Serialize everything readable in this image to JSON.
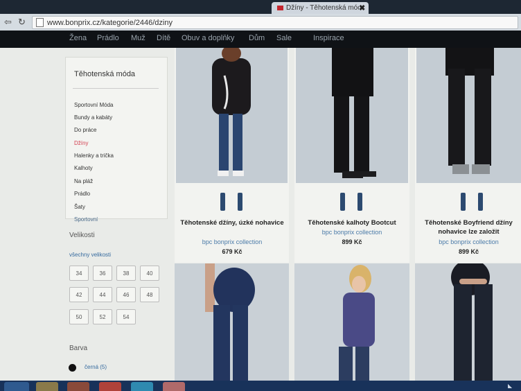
{
  "browser": {
    "tab_title": "Džíny - Těhotenská móda",
    "tab_close": "✖",
    "url": "www.bonprix.cz/kategorie/2446/dziny",
    "back_glyph": "⇦",
    "reload_glyph": "↻"
  },
  "site_nav": [
    "Žena",
    "Prádlo",
    "Muž",
    "Dítě",
    "Obuv a doplňky",
    "Dům",
    "Sale",
    "Inspirace"
  ],
  "sidebar": {
    "title": "Těhotenská móda",
    "categories": [
      "Sportovní Móda",
      "Bundy a kabáty",
      "Do práce",
      "Džíny",
      "Halenky a trička",
      "Kalhoty",
      "Na pláž",
      "Prádlo",
      "Šaty",
      "Sportovní"
    ],
    "active_index": 3,
    "size_label": "Velikosti",
    "all_sizes": "všechny velikosti",
    "sizes": [
      "34",
      "36",
      "38",
      "40",
      "42",
      "44",
      "46",
      "48",
      "50",
      "52",
      "54"
    ],
    "color_label": "Barva",
    "color_option": "černá (5)"
  },
  "products": [
    {
      "name": "Těhotenské džíny, úzké nohavice",
      "brand": "bpc bonprix collection",
      "price": "679 Kč"
    },
    {
      "name": "Těhotenské kalhoty Bootcut",
      "brand": "bpc bonprix collection",
      "price": "899 Kč"
    },
    {
      "name": "Těhotenské Boyfriend džíny nohavice lze založit",
      "brand": "bpc bonprix collection",
      "price": "899 Kč"
    }
  ],
  "icons": {
    "page": "page-icon",
    "swatch": "color-swatch-black"
  },
  "colors": {
    "active_category": "#d23e4f",
    "brand_link": "#4a7aa8",
    "nav_bg": "#0f1216"
  }
}
